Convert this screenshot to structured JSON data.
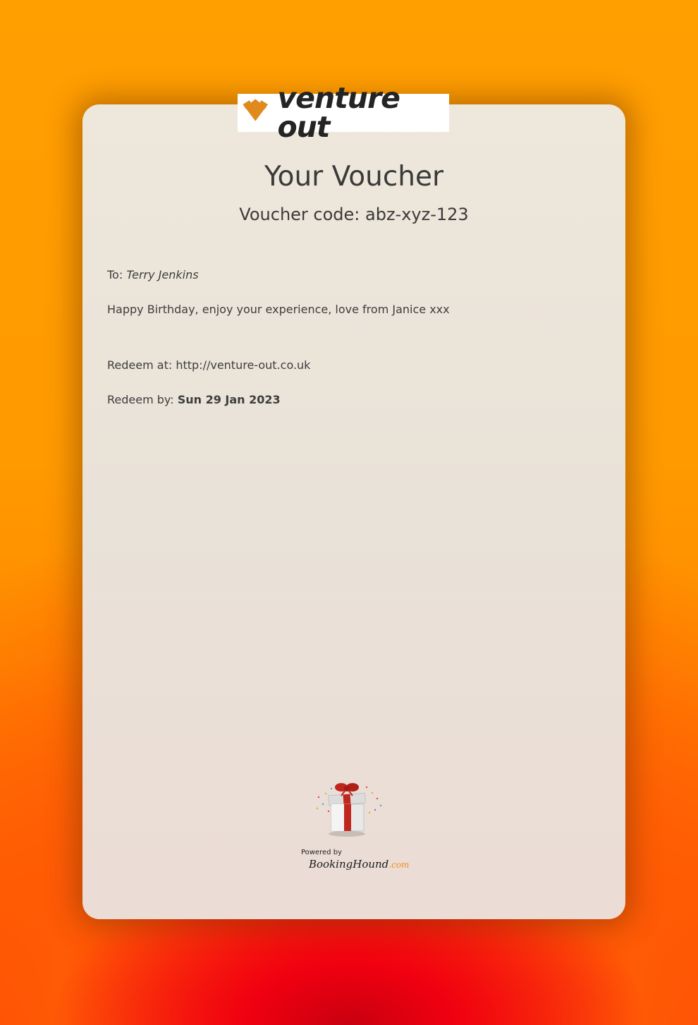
{
  "brand": {
    "name": "venture out"
  },
  "voucher": {
    "title": "Your Voucher",
    "code_line": "Voucher code: abz-xyz-123"
  },
  "details": {
    "to_label": "To:",
    "to_name": "Terry Jenkins",
    "message": "Happy Birthday, enjoy your experience, love from Janice xxx",
    "redeem_at_label": "Redeem at:",
    "redeem_at_url": "http://venture-out.co.uk",
    "redeem_by_label": "Redeem by:",
    "redeem_by_date": "Sun 29 Jan 2023"
  },
  "footer": {
    "powered_by": "Powered by",
    "provider": "BookingHound",
    "provider_suffix": ".com",
    "icon": "gift-box-icon"
  },
  "colors": {
    "background_top": "#ff9f00",
    "background_bottom": "#f00010",
    "card": "#ebe4da",
    "logo_accent": "#e08a1e",
    "text": "#3a3a3a"
  }
}
